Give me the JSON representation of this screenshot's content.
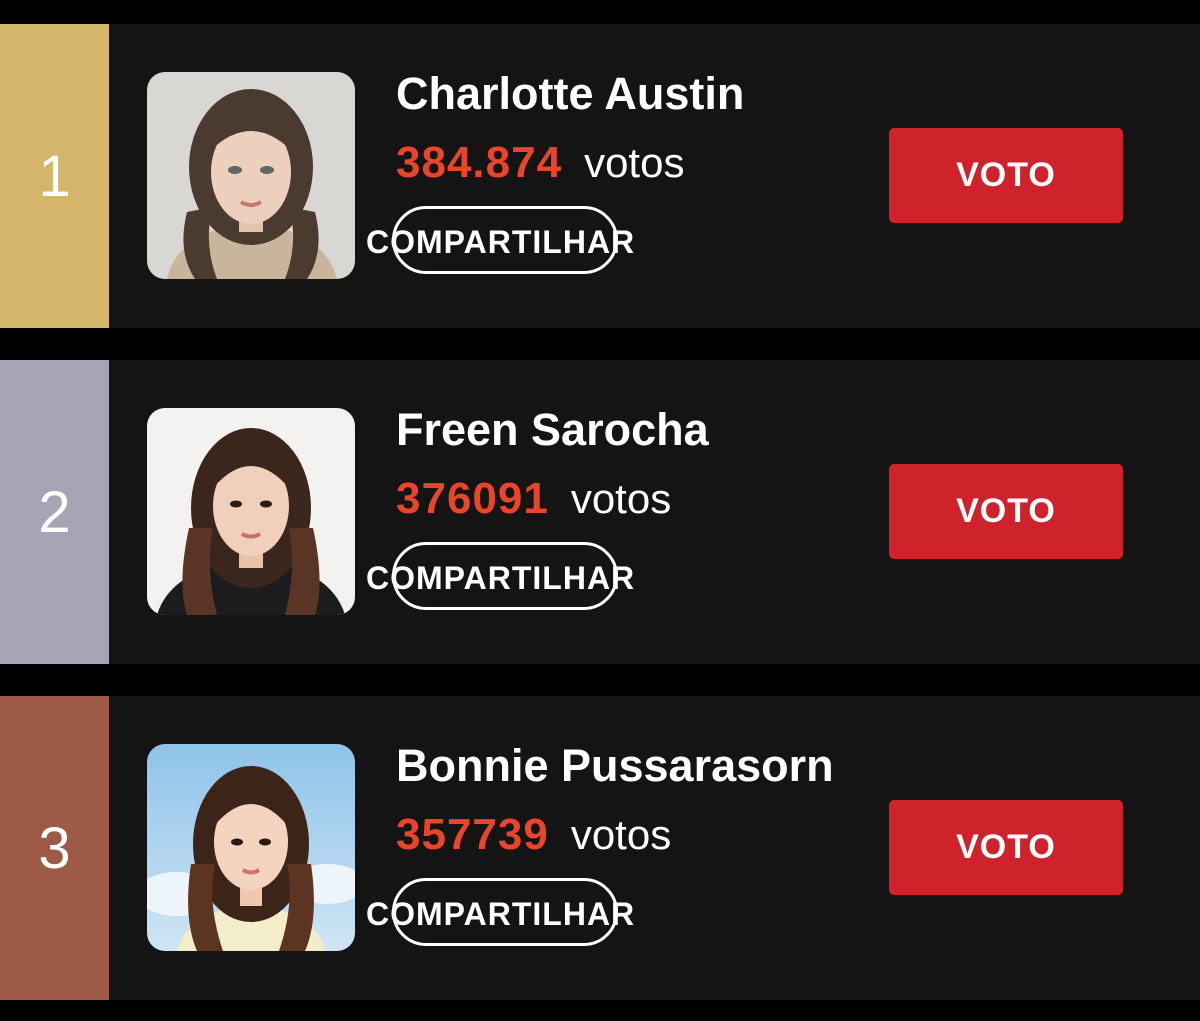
{
  "colors": {
    "background": "#000000",
    "card": "#141414",
    "vote_count": "#e8452a",
    "vote_button": "#cf232b",
    "rank_1": "#d5b56b",
    "rank_2": "#a9a3b6",
    "rank_3": "#9c5a47"
  },
  "entries": [
    {
      "rank": "1",
      "name": "Charlotte Austin",
      "votes": "384.874",
      "votes_unit": "votos",
      "share_label": "COMPARTILHAR",
      "vote_label": "VOTO",
      "avatar_icon": "portrait-photo"
    },
    {
      "rank": "2",
      "name": "Freen Sarocha",
      "votes": "376091",
      "votes_unit": "votos",
      "share_label": "COMPARTILHAR",
      "vote_label": "VOTO",
      "avatar_icon": "portrait-photo"
    },
    {
      "rank": "3",
      "name": "Bonnie Pussarasorn",
      "votes": "357739",
      "votes_unit": "votos",
      "share_label": "COMPARTILHAR",
      "vote_label": "VOTO",
      "avatar_icon": "portrait-photo"
    }
  ]
}
